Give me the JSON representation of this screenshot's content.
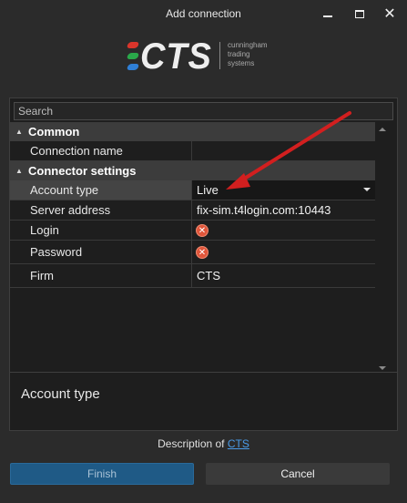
{
  "window": {
    "title": "Add connection",
    "controls": {
      "minimize": "minimize",
      "maximize": "maximize",
      "close": "close"
    }
  },
  "logo": {
    "mark": "CTS",
    "tagline_lines": [
      "cunningham",
      "trading",
      "systems"
    ],
    "bar_colors": [
      "#d9352b",
      "#2aa84a",
      "#2f7fd6"
    ]
  },
  "search": {
    "placeholder": "Search",
    "value": ""
  },
  "grid": {
    "categories": [
      {
        "label": "Common"
      },
      {
        "label": "Connector settings"
      }
    ],
    "rows": {
      "connection_name": {
        "name": "Connection name",
        "value": ""
      },
      "account_type": {
        "name": "Account type",
        "value": "Live"
      },
      "server_address": {
        "name": "Server address",
        "value": "fix-sim.t4login.com:10443"
      },
      "login": {
        "name": "Login",
        "value": ""
      },
      "password": {
        "name": "Password",
        "value": ""
      },
      "firm": {
        "name": "Firm",
        "value": "CTS"
      }
    }
  },
  "description_panel": {
    "title": "Account type"
  },
  "footer": {
    "description_prefix": "Description of ",
    "description_link": "CTS"
  },
  "buttons": {
    "finish": "Finish",
    "cancel": "Cancel"
  },
  "colors": {
    "accent": "#1f5a86",
    "error": "#e0563b",
    "annotation_arrow": "#d21f1f",
    "link": "#4a9be8"
  }
}
